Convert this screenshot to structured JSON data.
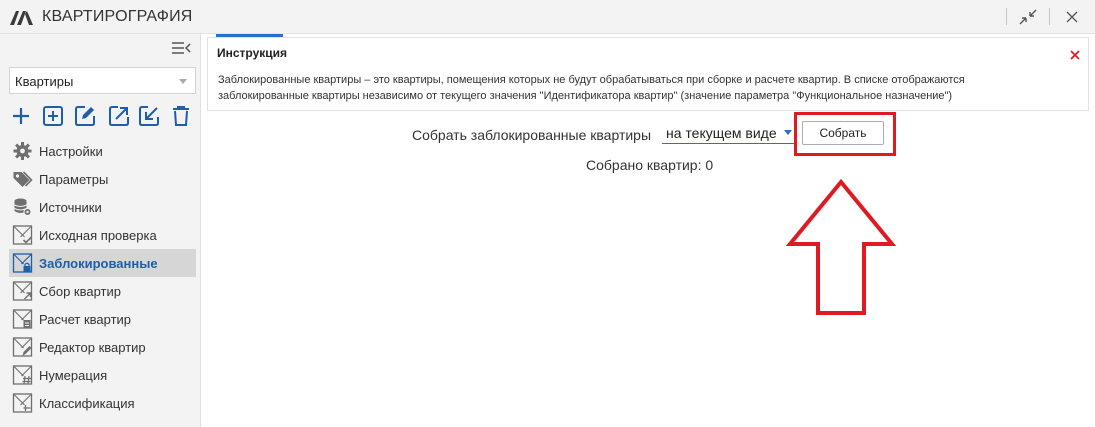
{
  "app": {
    "title": "КВАРТИРОГРАФИЯ"
  },
  "colors": {
    "accent": "#2a6fcf",
    "active_text": "#1f5ea8",
    "highlight": "#e01a22"
  },
  "sidebar": {
    "category_selected": "Квартиры",
    "toolbar_icons": [
      "add-icon",
      "add-box-icon",
      "edit-icon",
      "export-icon",
      "import-icon",
      "delete-icon"
    ],
    "items": [
      {
        "label": "Настройки",
        "icon": "gear-icon"
      },
      {
        "label": "Параметры",
        "icon": "tags-icon"
      },
      {
        "label": "Источники",
        "icon": "database-gear-icon"
      },
      {
        "label": "Исходная проверка",
        "icon": "check-plan-icon"
      },
      {
        "label": "Заблокированные",
        "icon": "lock-plan-icon"
      },
      {
        "label": "Сбор квартир",
        "icon": "collect-plan-icon"
      },
      {
        "label": "Расчет квартир",
        "icon": "calc-plan-icon"
      },
      {
        "label": "Редактор квартир",
        "icon": "edit-plan-icon"
      },
      {
        "label": "Нумерация",
        "icon": "number-plan-icon"
      },
      {
        "label": "Классификация",
        "icon": "classify-plan-icon"
      }
    ]
  },
  "main": {
    "instruction": {
      "title": "Инструкция",
      "line1": "Заблокированные квартиры – это квартиры, помещения которых не будут обрабатываться при сборке и расчете квартир. В списке отображаются",
      "line2": "заблокированные квартиры независимо от текущего значения \"Идентификатора квартир\" (значение параметра \"Функциональное назначение\")"
    },
    "collect_label": "Собрать заблокированные квартиры",
    "scope_value": "на текущем виде",
    "collect_button": "Собрать",
    "count_text": "Собрано квартир: 0"
  }
}
